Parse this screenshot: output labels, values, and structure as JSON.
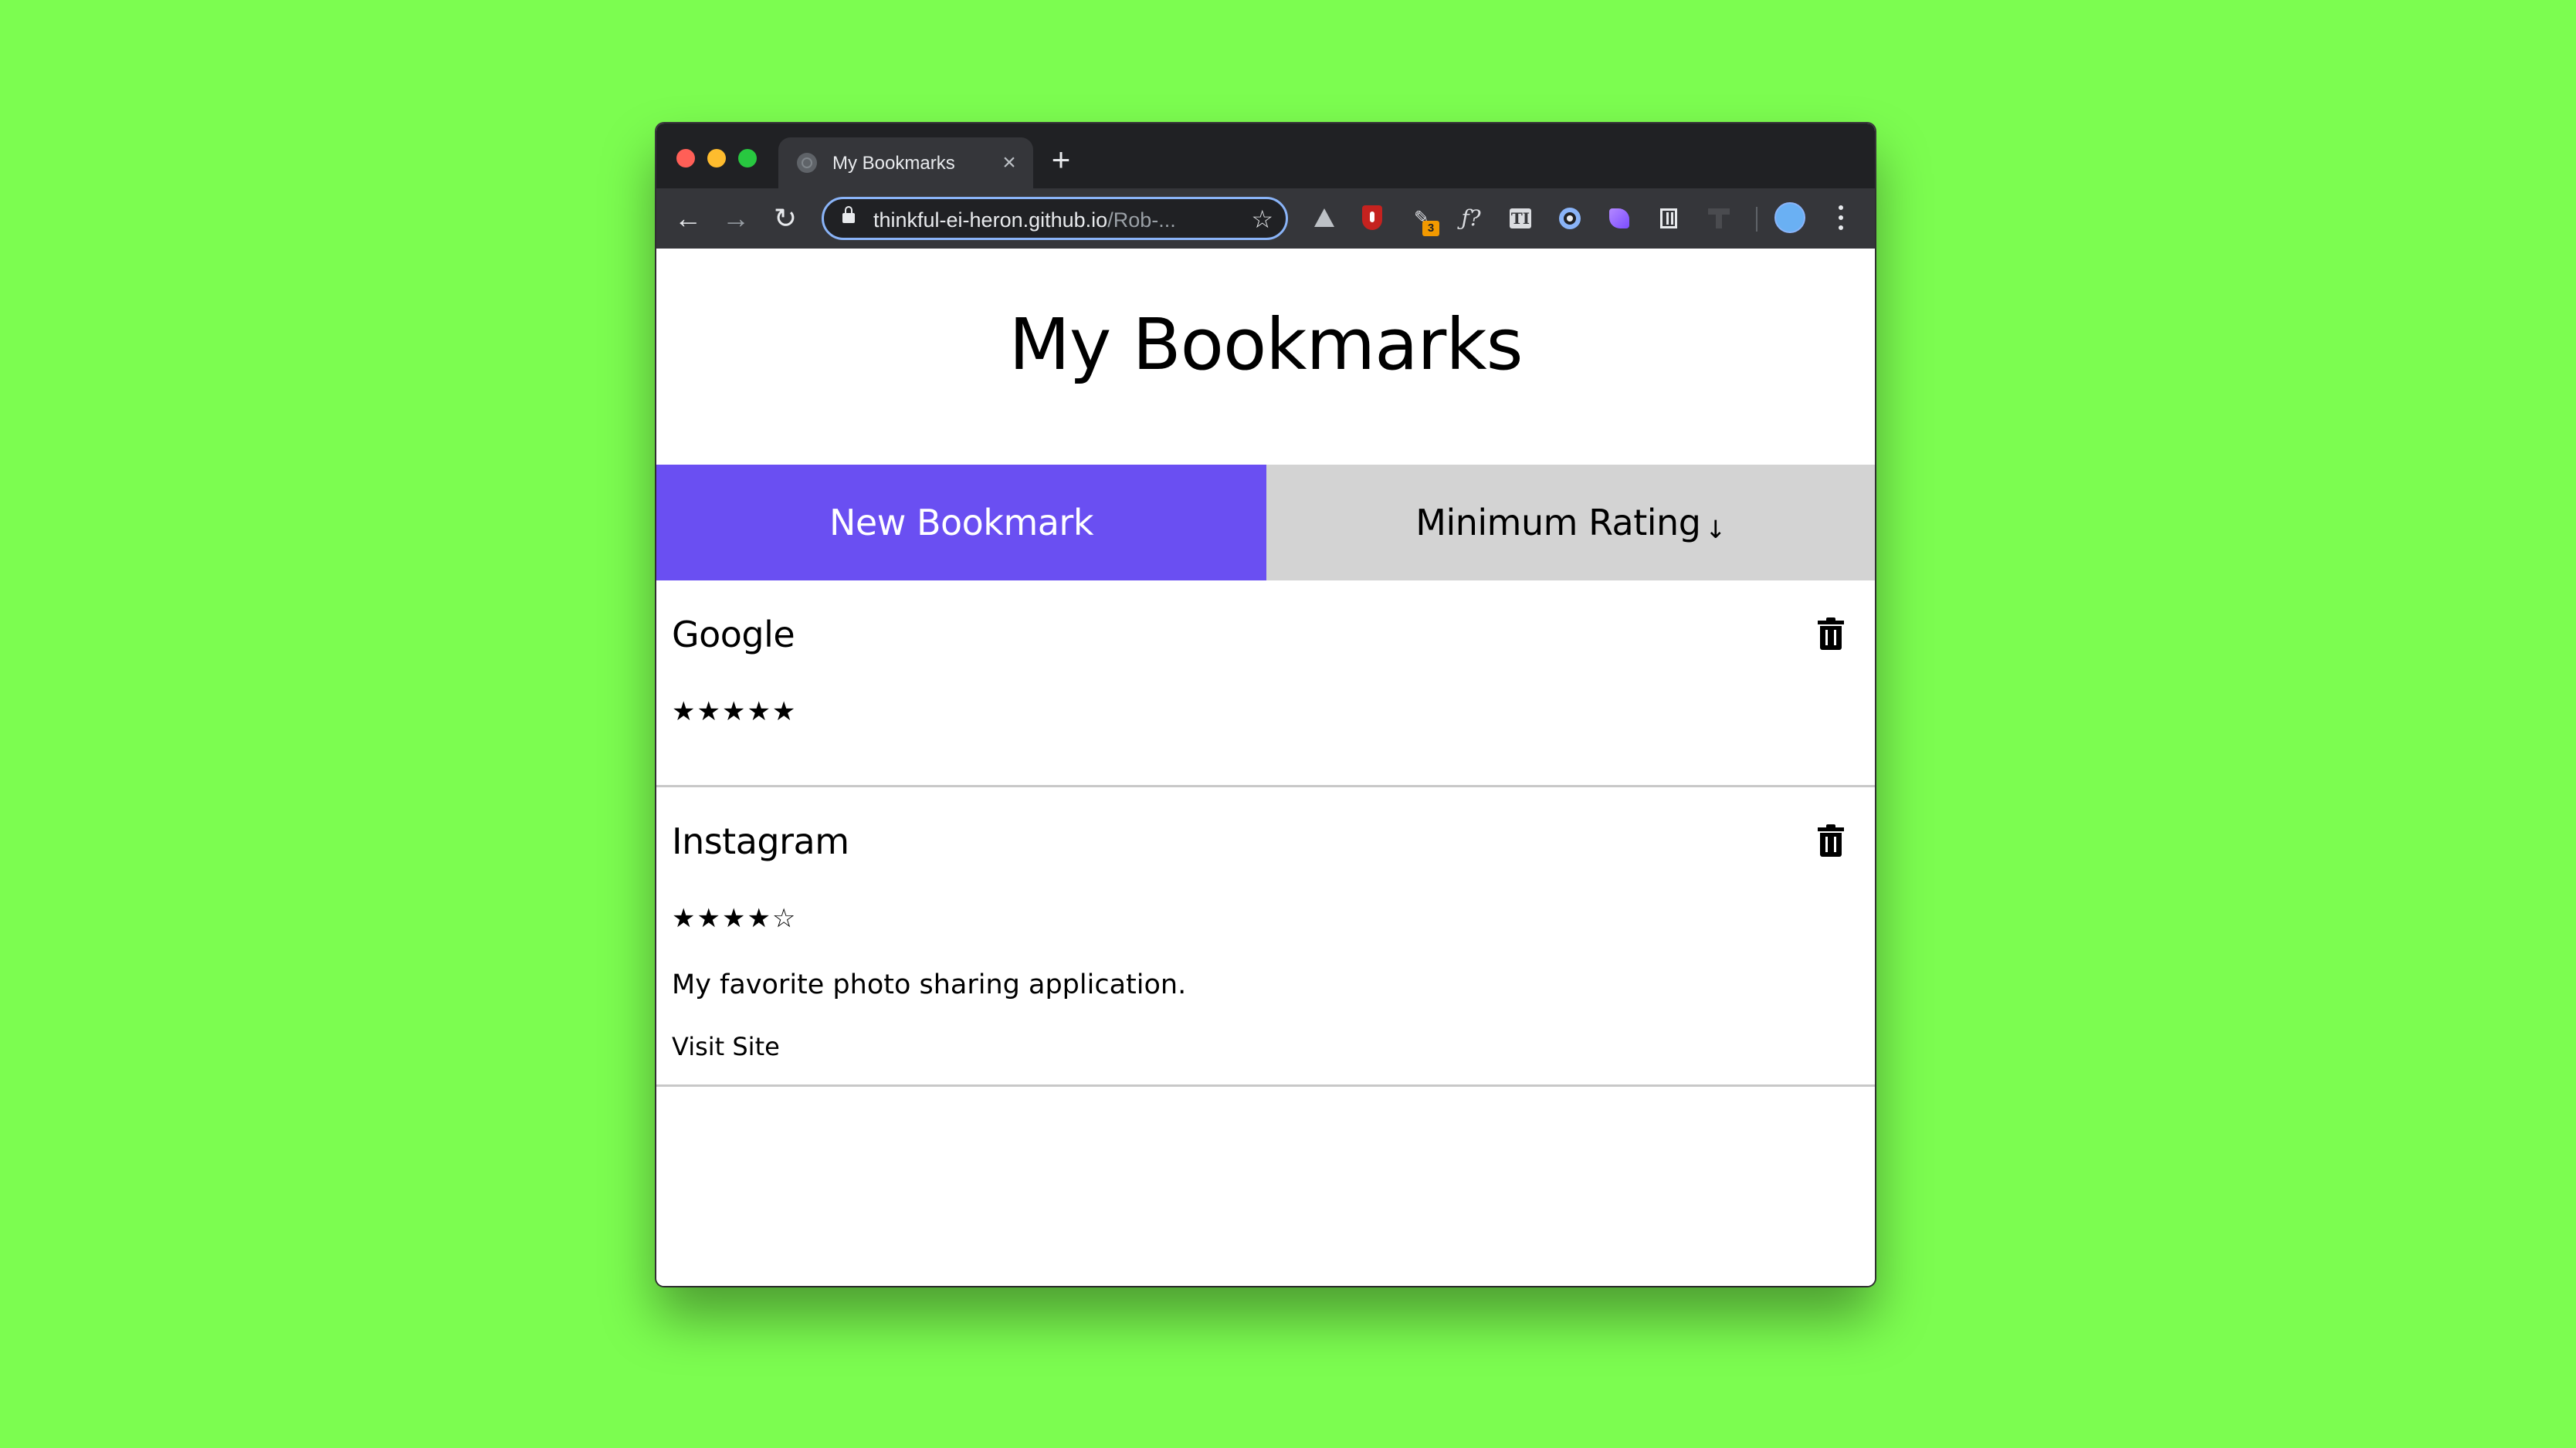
{
  "colors": {
    "background": "#7cfd50",
    "primary_button": "#6a4ff2",
    "select_background": "#d3d3d3"
  },
  "browser": {
    "tab": {
      "title": "My Bookmarks",
      "favicon": "globe-icon",
      "close_icon": "×"
    },
    "new_tab_icon": "+",
    "nav": {
      "back_icon": "←",
      "forward_icon": "→",
      "reload_icon": "↻"
    },
    "omnibox": {
      "url_host": "thinkful-ei-heron.github.io",
      "url_path": "/Rob-...",
      "bookmark_star_icon": "☆"
    },
    "extensions": [
      "google-drive-icon",
      "ublock-icon",
      "extension-icon",
      "math-icon",
      "text-icon",
      "circle-icon",
      "purple-extension-icon",
      "trash-icon",
      "disabled-extension-icon"
    ],
    "extension_badge": "3",
    "extension_math_label": "ƒ?",
    "extension_text_label": "TI"
  },
  "page": {
    "title": "My Bookmarks",
    "new_bookmark_label": "New Bookmark",
    "rating_filter_label": "Minimum Rating",
    "rating_filter_arrow": "↓",
    "bookmarks": [
      {
        "title": "Google",
        "stars": "★★★★★",
        "rating": 5
      },
      {
        "title": "Instagram",
        "stars": "★★★★☆",
        "rating": 4,
        "description": "My favorite photo sharing application.",
        "link_label": "Visit Site"
      }
    ]
  }
}
